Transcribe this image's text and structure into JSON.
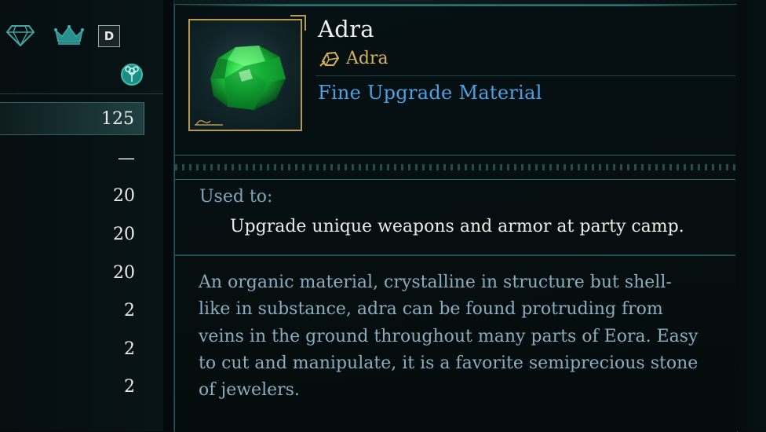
{
  "left_panel": {
    "icons": {
      "gem": "diamond-icon",
      "crown": "crown-icon",
      "d_badge": "D",
      "tree": "tree-emblem-icon"
    },
    "quantities": [
      "125",
      "—",
      "20",
      "20",
      "20",
      "2",
      "2",
      "2"
    ],
    "selected_index": 0
  },
  "item": {
    "name": "Adra",
    "source": "Adra",
    "source_icon": "ore-icon",
    "category": "Fine Upgrade Material",
    "usage_label": "Used to:",
    "usage_text": "Upgrade unique weapons and armor at party camp.",
    "description_lines": [
      "An organic material, crystalline in structure but shell-",
      "like in substance, adra can be found protruding from",
      "veins in the ground throughout many parts of Eora. Easy",
      "to cut and manipulate, it is a favorite semiprecious stone",
      "of jewelers."
    ]
  },
  "colors": {
    "accent_teal": "#2e7173",
    "gold": "#b99a50",
    "category_blue": "#4aa2e6",
    "description": "#89aebf"
  }
}
